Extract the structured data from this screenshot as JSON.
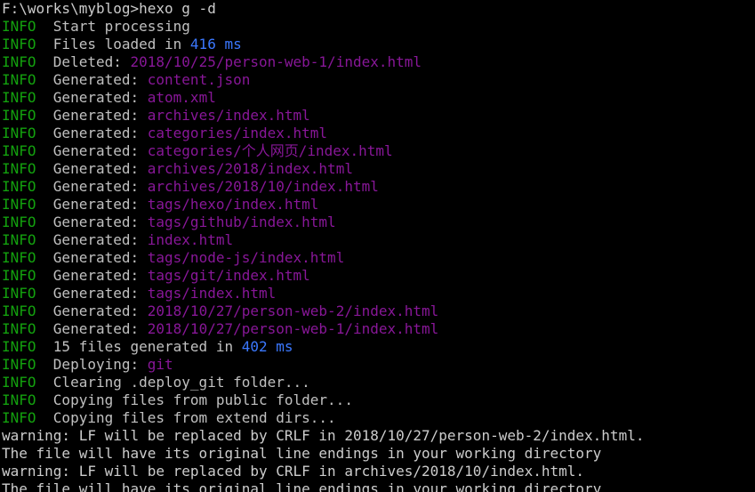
{
  "terminal": {
    "prompt": "F:\\works\\myblog>hexo g -d",
    "colors": {
      "info": "#13a10e",
      "text": "#c0c0c0",
      "path": "#881798",
      "number": "#3b78ff",
      "background": "#000000"
    },
    "lines": [
      {
        "level": "INFO",
        "parts": [
          {
            "t": "  Start processing",
            "c": "msg"
          }
        ]
      },
      {
        "level": "INFO",
        "parts": [
          {
            "t": "  Files loaded in ",
            "c": "msg"
          },
          {
            "t": "416 ms",
            "c": "num"
          }
        ]
      },
      {
        "level": "INFO",
        "parts": [
          {
            "t": "  Deleted: ",
            "c": "msg"
          },
          {
            "t": "2018/10/25/person-web-1/index.html",
            "c": "path"
          }
        ]
      },
      {
        "level": "INFO",
        "parts": [
          {
            "t": "  Generated: ",
            "c": "msg"
          },
          {
            "t": "content.json",
            "c": "path"
          }
        ]
      },
      {
        "level": "INFO",
        "parts": [
          {
            "t": "  Generated: ",
            "c": "msg"
          },
          {
            "t": "atom.xml",
            "c": "path"
          }
        ]
      },
      {
        "level": "INFO",
        "parts": [
          {
            "t": "  Generated: ",
            "c": "msg"
          },
          {
            "t": "archives/index.html",
            "c": "path"
          }
        ]
      },
      {
        "level": "INFO",
        "parts": [
          {
            "t": "  Generated: ",
            "c": "msg"
          },
          {
            "t": "categories/index.html",
            "c": "path"
          }
        ]
      },
      {
        "level": "INFO",
        "parts": [
          {
            "t": "  Generated: ",
            "c": "msg"
          },
          {
            "t": "categories/个人网页/index.html",
            "c": "path"
          }
        ]
      },
      {
        "level": "INFO",
        "parts": [
          {
            "t": "  Generated: ",
            "c": "msg"
          },
          {
            "t": "archives/2018/index.html",
            "c": "path"
          }
        ]
      },
      {
        "level": "INFO",
        "parts": [
          {
            "t": "  Generated: ",
            "c": "msg"
          },
          {
            "t": "archives/2018/10/index.html",
            "c": "path"
          }
        ]
      },
      {
        "level": "INFO",
        "parts": [
          {
            "t": "  Generated: ",
            "c": "msg"
          },
          {
            "t": "tags/hexo/index.html",
            "c": "path"
          }
        ]
      },
      {
        "level": "INFO",
        "parts": [
          {
            "t": "  Generated: ",
            "c": "msg"
          },
          {
            "t": "tags/github/index.html",
            "c": "path"
          }
        ]
      },
      {
        "level": "INFO",
        "parts": [
          {
            "t": "  Generated: ",
            "c": "msg"
          },
          {
            "t": "index.html",
            "c": "path"
          }
        ]
      },
      {
        "level": "INFO",
        "parts": [
          {
            "t": "  Generated: ",
            "c": "msg"
          },
          {
            "t": "tags/node-js/index.html",
            "c": "path"
          }
        ]
      },
      {
        "level": "INFO",
        "parts": [
          {
            "t": "  Generated: ",
            "c": "msg"
          },
          {
            "t": "tags/git/index.html",
            "c": "path"
          }
        ]
      },
      {
        "level": "INFO",
        "parts": [
          {
            "t": "  Generated: ",
            "c": "msg"
          },
          {
            "t": "tags/index.html",
            "c": "path"
          }
        ]
      },
      {
        "level": "INFO",
        "parts": [
          {
            "t": "  Generated: ",
            "c": "msg"
          },
          {
            "t": "2018/10/27/person-web-2/index.html",
            "c": "path"
          }
        ]
      },
      {
        "level": "INFO",
        "parts": [
          {
            "t": "  Generated: ",
            "c": "msg"
          },
          {
            "t": "2018/10/27/person-web-1/index.html",
            "c": "path"
          }
        ]
      },
      {
        "level": "INFO",
        "parts": [
          {
            "t": "  15 files generated in ",
            "c": "msg"
          },
          {
            "t": "402 ms",
            "c": "num"
          }
        ]
      },
      {
        "level": "INFO",
        "parts": [
          {
            "t": "  Deploying: ",
            "c": "msg"
          },
          {
            "t": "git",
            "c": "path"
          }
        ]
      },
      {
        "level": "INFO",
        "parts": [
          {
            "t": "  Clearing .deploy_git folder...",
            "c": "msg"
          }
        ]
      },
      {
        "level": "INFO",
        "parts": [
          {
            "t": "  Copying files from public folder...",
            "c": "msg"
          }
        ]
      },
      {
        "level": "INFO",
        "parts": [
          {
            "t": "  Copying files from extend dirs...",
            "c": "msg"
          }
        ]
      },
      {
        "level": "",
        "parts": [
          {
            "t": "warning: LF will be replaced by CRLF in 2018/10/27/person-web-2/index.html.",
            "c": "plain"
          }
        ]
      },
      {
        "level": "",
        "parts": [
          {
            "t": "The file will have its original line endings in your working directory",
            "c": "plain"
          }
        ]
      },
      {
        "level": "",
        "parts": [
          {
            "t": "warning: LF will be replaced by CRLF in archives/2018/10/index.html.",
            "c": "plain"
          }
        ]
      },
      {
        "level": "",
        "parts": [
          {
            "t": "The file will have its original line endings in your working directory",
            "c": "plain"
          }
        ]
      }
    ]
  }
}
